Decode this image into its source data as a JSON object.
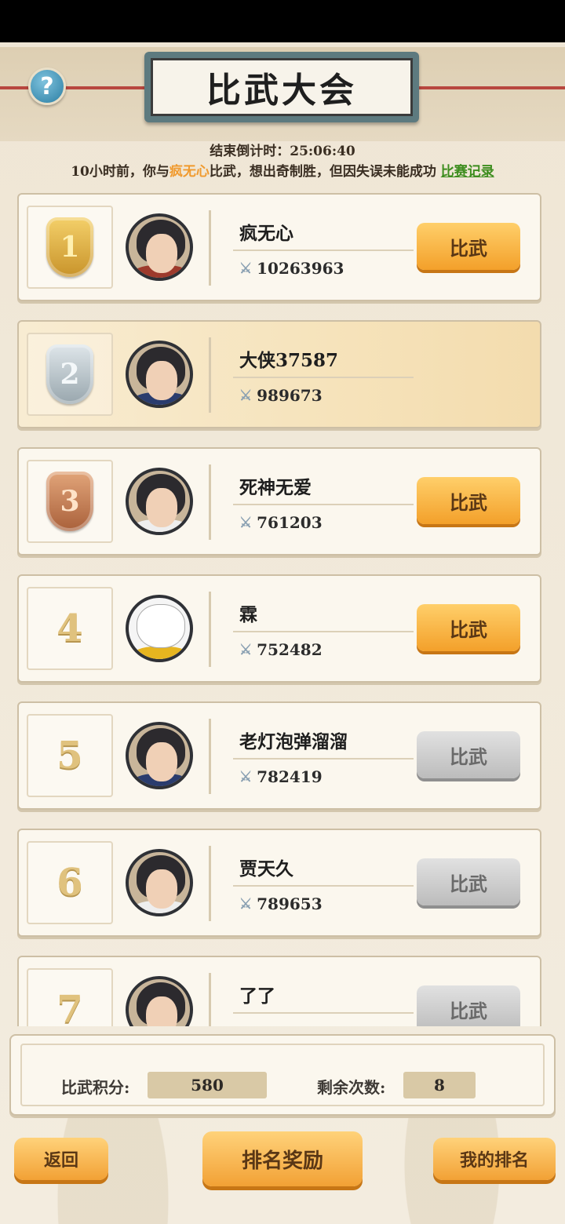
{
  "header": {
    "title": "比武大会",
    "help_symbol": "?"
  },
  "countdown": {
    "text": "结束倒计时：25:06:40"
  },
  "battle_log": {
    "prefix": "10小时前，你与",
    "opponent": "疯无心",
    "suffix": "比武，想出奇制胜，但因失误未能成功",
    "link": "比赛记录"
  },
  "ranking": [
    {
      "rank": "1",
      "medal": "gold",
      "name": "疯无心",
      "power": "10263963",
      "button": "比武",
      "button_state": "active",
      "avatar": "warrior"
    },
    {
      "rank": "2",
      "medal": "silver",
      "name": "大侠37587",
      "power": "989673",
      "button": "",
      "button_state": "self",
      "avatar": "lady"
    },
    {
      "rank": "3",
      "medal": "bronze",
      "name": "死神无爱",
      "power": "761203",
      "button": "比武",
      "button_state": "active",
      "avatar": "scholar"
    },
    {
      "rank": "4",
      "medal": "",
      "name": "霖",
      "power": "752482",
      "button": "比武",
      "button_state": "active",
      "avatar": "panda"
    },
    {
      "rank": "5",
      "medal": "",
      "name": "老灯泡弹溜溜",
      "power": "782419",
      "button": "比武",
      "button_state": "disabled",
      "avatar": "lady"
    },
    {
      "rank": "6",
      "medal": "",
      "name": "贾天久",
      "power": "789653",
      "button": "比武",
      "button_state": "disabled",
      "avatar": "scholar"
    },
    {
      "rank": "7",
      "medal": "",
      "name": "了了",
      "power": "",
      "button": "比武",
      "button_state": "disabled",
      "avatar": "scholar"
    }
  ],
  "stats": {
    "score_label": "比武积分:",
    "score_value": "580",
    "remaining_label": "剩余次数:",
    "remaining_value": "8"
  },
  "bottom_bar": {
    "back": "返回",
    "rewards": "排名奖励",
    "my_rank": "我的排名"
  },
  "colors": {
    "accent_orange": "#f3a02a",
    "link_green": "#3d8d1e",
    "highlight_orange": "#f09a2e"
  }
}
